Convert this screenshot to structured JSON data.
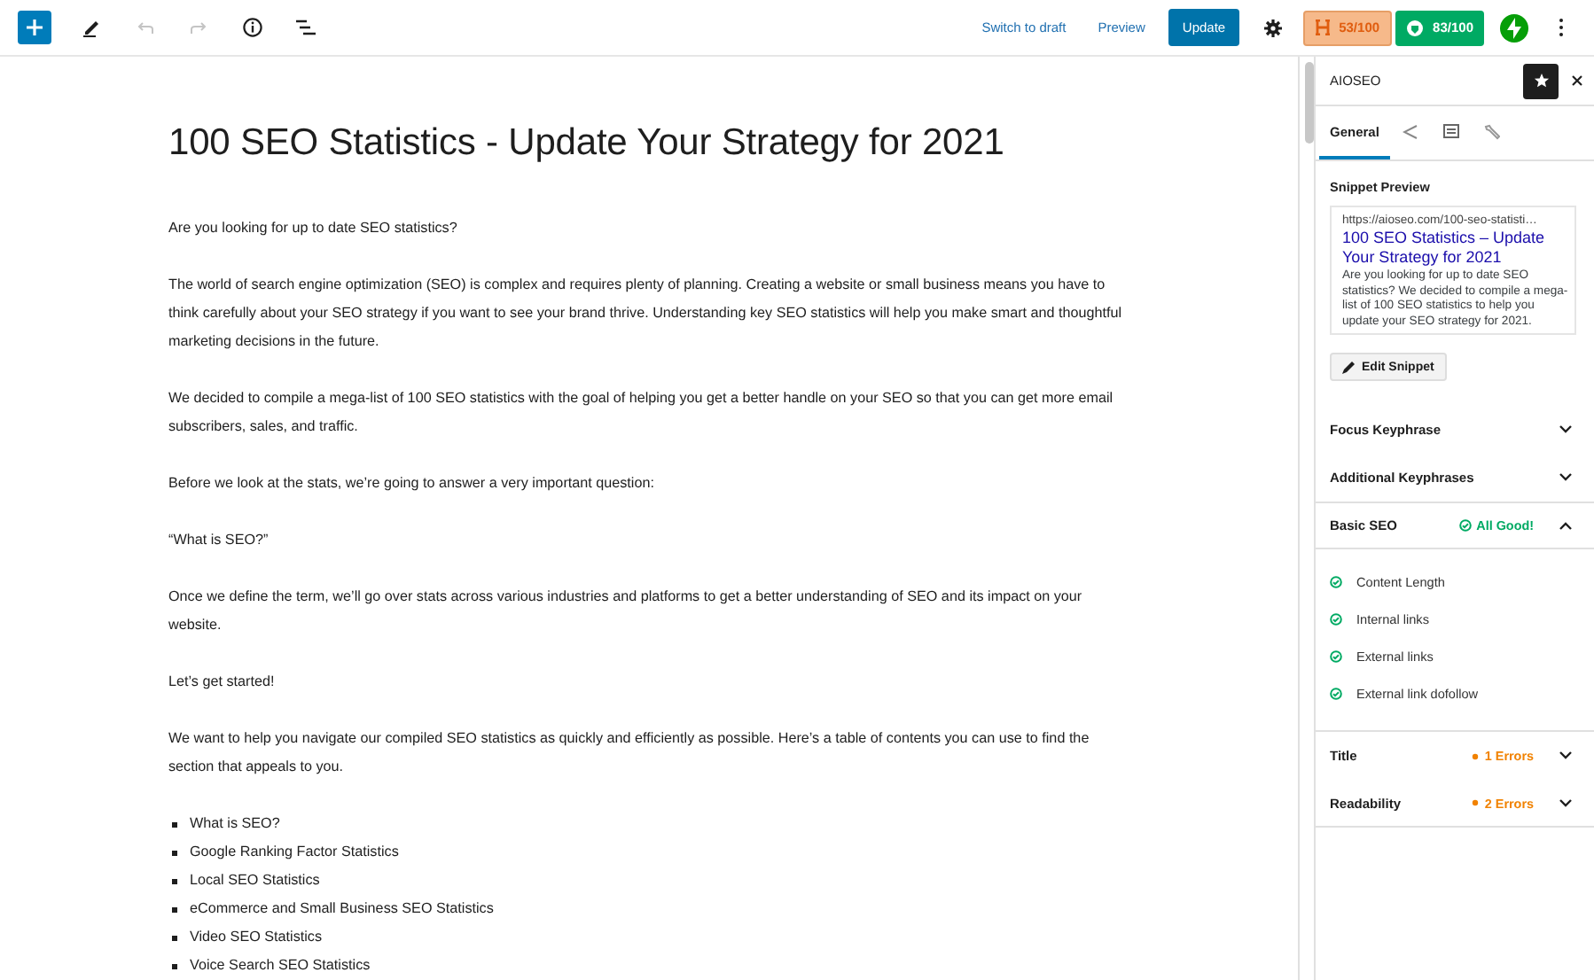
{
  "toolbar": {
    "undo_disabled": true,
    "redo_disabled": true,
    "links": [
      "Switch to draft",
      "Preview"
    ],
    "primary_button": "Update",
    "scores": [
      {
        "kind": "headline",
        "text": "53/100",
        "color": "#f6b98a"
      },
      {
        "kind": "truseo",
        "text": "83/100",
        "color": "#00aa63"
      }
    ]
  },
  "post": {
    "title": "100 SEO Statistics - Update Your Strategy for 2021",
    "paragraphs": [
      "Are you looking for up to date SEO statistics?",
      "The world of search engine optimization (SEO) is complex and requires plenty of planning. Creating a website or small business means you have to think carefully about your SEO strategy if you want to see your brand thrive. Understanding key SEO statistics will help you make smart and thoughtful marketing decisions in the future.",
      "We decided to compile a mega-list of 100 SEO statistics with the goal of helping you get a better handle on your SEO so that you can get more email subscribers, sales, and traffic.",
      "Before we look at the stats, we’re going to answer a very important question:",
      "“What is SEO?”",
      "Once we define the term, we’ll go over stats across various industries and platforms to get a better understanding of SEO and its impact on your website.",
      "Let’s get started!",
      "We want to help you navigate our compiled SEO statistics as quickly and efficiently as possible. Here’s a table of contents you can use to find the section that appeals to you."
    ],
    "list": [
      "What is SEO?",
      "Google Ranking Factor Statistics",
      "Local SEO Statistics",
      "eCommerce and Small Business SEO Statistics",
      "Video SEO Statistics",
      "Voice Search SEO Statistics"
    ]
  },
  "sidebar": {
    "title": "AIOSEO",
    "pinned": true,
    "tabs": [
      {
        "label": "General",
        "selected": true
      },
      {
        "selected": false
      },
      {
        "selected": false
      },
      {
        "selected": false
      }
    ],
    "snippet": {
      "heading": "Snippet Preview",
      "url": "https://aioseo.com/100-seo-statisti…",
      "title": "100 SEO Statistics – Update Your Strategy for 2021",
      "description": "Are you looking for up to date SEO statistics? We decided to compile a mega-list of 100 SEO statistics to help you update your SEO strategy for 2021.",
      "button": "Edit Snippet"
    },
    "panels": [
      {
        "title": "Focus Keyphrase",
        "expanded": false
      },
      {
        "title": "Additional Keyphrases",
        "expanded": false
      },
      {
        "title": "Basic SEO",
        "expanded": true,
        "status": {
          "kind": "good",
          "text": "All Good!"
        },
        "checks": [
          {
            "label": "Content Length",
            "passed": true
          },
          {
            "label": "Internal links",
            "passed": true
          },
          {
            "label": "External links",
            "passed": true
          },
          {
            "label": "External link dofollow",
            "passed": true
          }
        ]
      },
      {
        "title": "Title",
        "expanded": false,
        "status": {
          "kind": "error",
          "text": "1 Errors"
        }
      },
      {
        "title": "Readability",
        "expanded": false,
        "status": {
          "kind": "error",
          "text": "2 Errors"
        }
      }
    ]
  }
}
